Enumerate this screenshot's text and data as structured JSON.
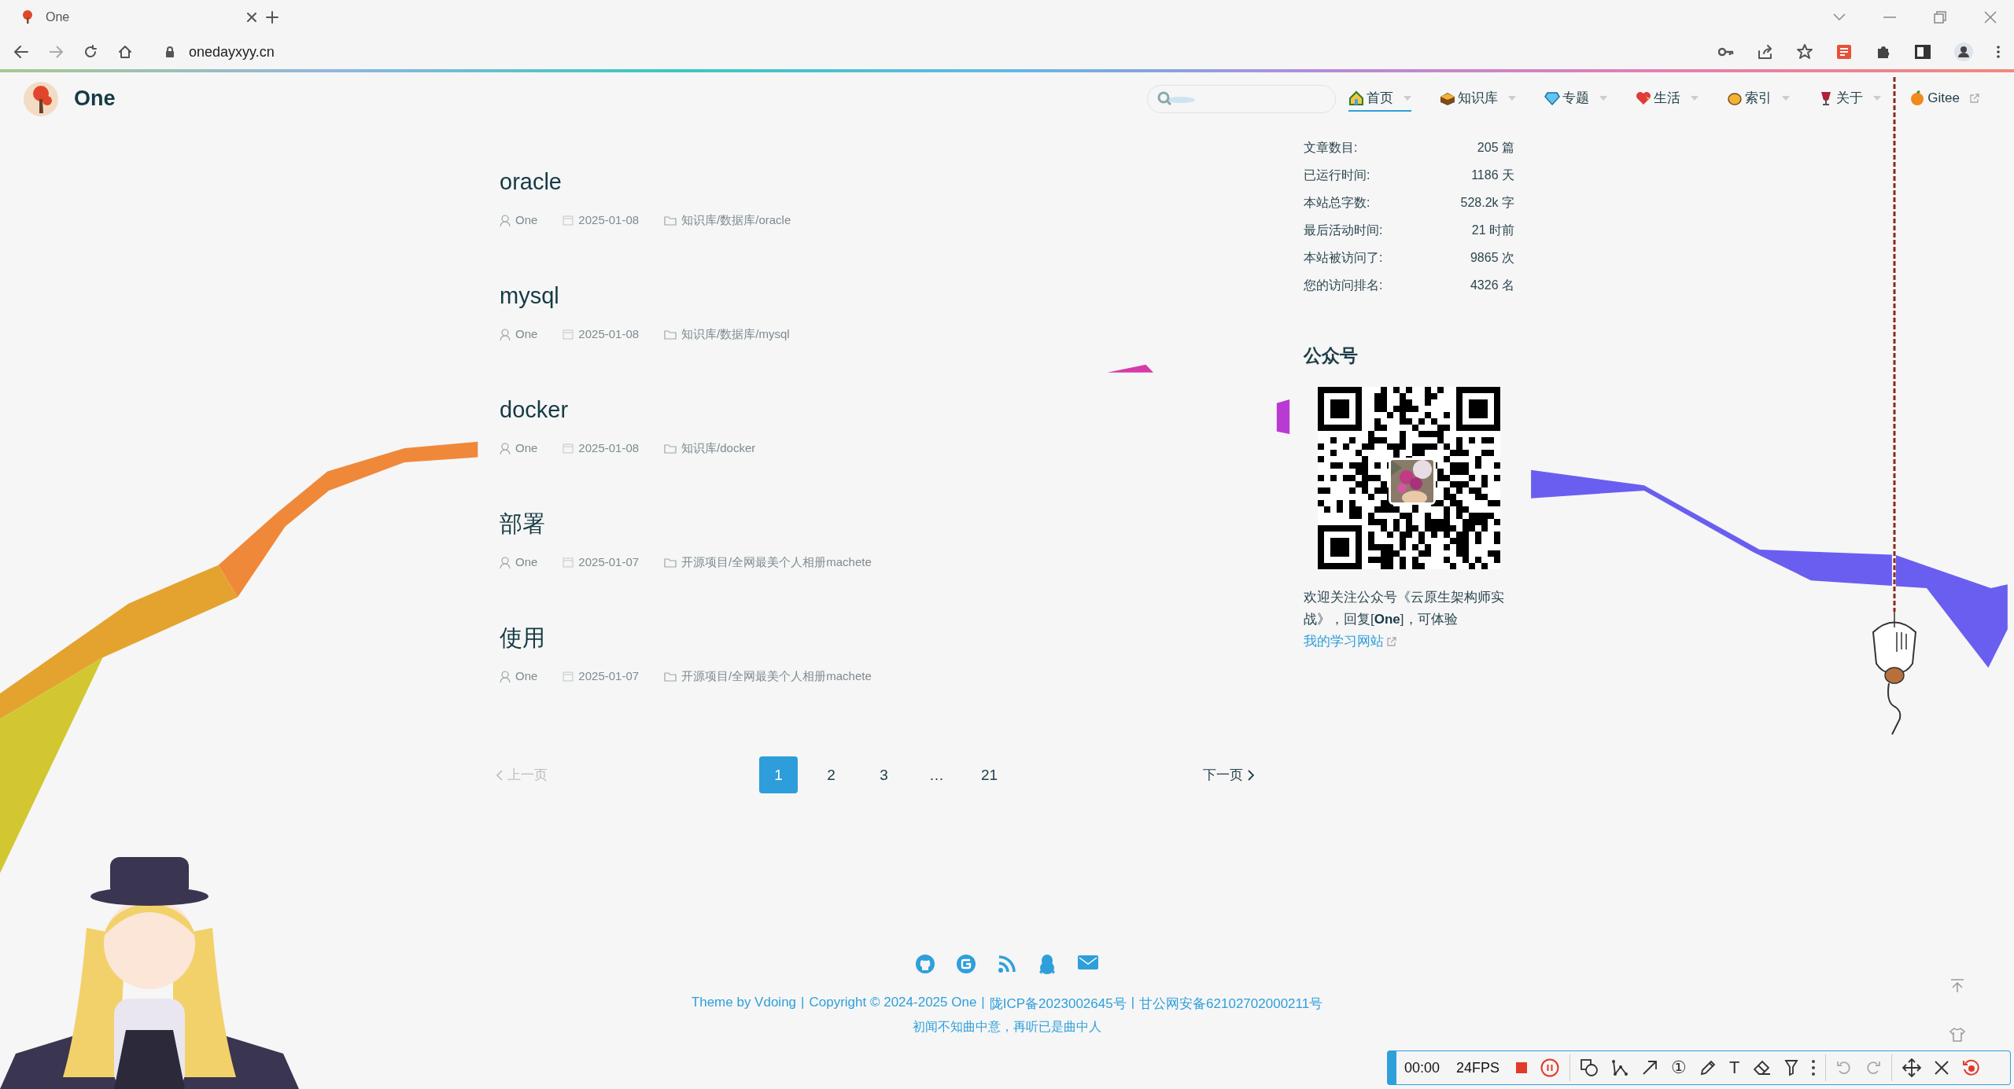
{
  "browser": {
    "tab_title": "One",
    "url": "onedayxyy.cn"
  },
  "site": {
    "title": "One",
    "nav": [
      {
        "label": "首页",
        "kind": "dropdown",
        "selected": true
      },
      {
        "label": "知识库",
        "kind": "dropdown",
        "selected": false
      },
      {
        "label": "专题",
        "kind": "dropdown",
        "selected": false
      },
      {
        "label": "生活",
        "kind": "dropdown",
        "selected": false
      },
      {
        "label": "索引",
        "kind": "dropdown",
        "selected": false
      },
      {
        "label": "关于",
        "kind": "dropdown",
        "selected": false
      },
      {
        "label": "Gitee",
        "kind": "external",
        "selected": false
      }
    ]
  },
  "posts": [
    {
      "title": "oracle",
      "author": "One",
      "date": "2025-01-08",
      "category": "知识库/数据库/oracle"
    },
    {
      "title": "mysql",
      "author": "One",
      "date": "2025-01-08",
      "category": "知识库/数据库/mysql"
    },
    {
      "title": "docker",
      "author": "One",
      "date": "2025-01-08",
      "category": "知识库/docker"
    },
    {
      "title": "部署",
      "author": "One",
      "date": "2025-01-07",
      "category": "开源项目/全网最美个人相册machete"
    },
    {
      "title": "使用",
      "author": "One",
      "date": "2025-01-07",
      "category": "开源项目/全网最美个人相册machete"
    }
  ],
  "pagination": {
    "prev": "上一页",
    "prev_disabled": true,
    "next": "下一页",
    "pages": [
      {
        "label": "1",
        "kind": "page",
        "selected": true
      },
      {
        "label": "2",
        "kind": "page",
        "selected": false
      },
      {
        "label": "3",
        "kind": "page",
        "selected": false
      },
      {
        "label": "…",
        "kind": "ellipsis",
        "selected": false
      },
      {
        "label": "21",
        "kind": "page",
        "selected": false
      }
    ]
  },
  "sidebar": {
    "stats": [
      {
        "label": "文章数目:",
        "value": "205 篇"
      },
      {
        "label": "已运行时间:",
        "value": "1186 天"
      },
      {
        "label": "本站总字数:",
        "value": "528.2k 字"
      },
      {
        "label": "最后活动时间:",
        "value": "21 时前"
      },
      {
        "label": "本站被访问了:",
        "value": "9865 次"
      },
      {
        "label": "您的访问排名:",
        "value": "4326 名"
      }
    ],
    "wechat": {
      "title": "公众号",
      "text": "欢迎关注公众号《云原生架构师实战》，回复[**One**]，可体验",
      "link": "我的学习网站"
    }
  },
  "footer": {
    "links": [
      "Theme by Vdoing",
      "Copyright © 2024-2025 One",
      "陇ICP备2023002645号",
      "甘公网安备62102702000211号"
    ],
    "separator": "|",
    "motto": "初闻不知曲中意，再听已是曲中人"
  },
  "recorder": {
    "time": "00:00",
    "fps": "24FPS",
    "number_tool": "①",
    "text_tool": "T"
  }
}
